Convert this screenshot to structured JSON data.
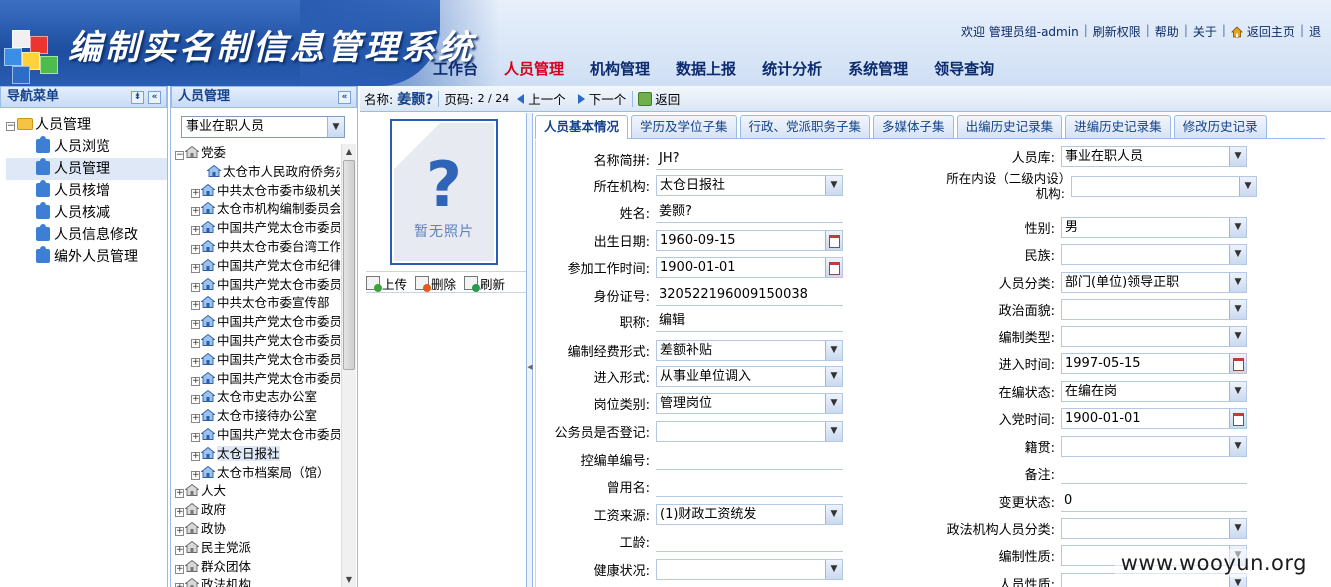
{
  "app": {
    "title": "编制实名制信息管理系统"
  },
  "top_links": {
    "welcome": "欢迎  管理员组-admin",
    "refresh": "刷新权限",
    "help": "帮助",
    "about": "关于",
    "home": "返回主页",
    "extra": "退"
  },
  "main_nav": [
    "工作台",
    "人员管理",
    "机构管理",
    "数据上报",
    "统计分析",
    "系统管理",
    "领导查询"
  ],
  "nav_panel": {
    "title": "导航菜单",
    "root": "人员管理",
    "items": [
      "人员浏览",
      "人员管理",
      "人员核增",
      "人员核减",
      "人员信息修改",
      "编外人员管理"
    ]
  },
  "person_panel": {
    "title": "人员管理",
    "status_value": "事业在职人员",
    "tree": [
      {
        "label": "党委",
        "level": 0,
        "toggle": "−"
      },
      {
        "label": "太仓市人民政府侨务办",
        "level": 2,
        "toggle": ""
      },
      {
        "label": "中共太仓市委市级机关",
        "level": 1,
        "toggle": "+"
      },
      {
        "label": "太仓市机构编制委员会",
        "level": 1,
        "toggle": "+"
      },
      {
        "label": "中国共产党太仓市委员",
        "level": 1,
        "toggle": "+"
      },
      {
        "label": "中共太仓市委台湾工作",
        "level": 1,
        "toggle": "+"
      },
      {
        "label": "中国共产党太仓市纪律",
        "level": 1,
        "toggle": "+"
      },
      {
        "label": "中国共产党太仓市委员",
        "level": 1,
        "toggle": "+"
      },
      {
        "label": "中共太仓市委宣传部",
        "level": 1,
        "toggle": "+"
      },
      {
        "label": "中国共产党太仓市委员",
        "level": 1,
        "toggle": "+"
      },
      {
        "label": "中国共产党太仓市委员",
        "level": 1,
        "toggle": "+"
      },
      {
        "label": "中国共产党太仓市委员",
        "level": 1,
        "toggle": "+"
      },
      {
        "label": "中国共产党太仓市委员",
        "level": 1,
        "toggle": "+"
      },
      {
        "label": "太仓市史志办公室",
        "level": 1,
        "toggle": "+"
      },
      {
        "label": "太仓市接待办公室",
        "level": 1,
        "toggle": "+"
      },
      {
        "label": "中国共产党太仓市委员",
        "level": 1,
        "toggle": "+"
      },
      {
        "label": "太仓日报社",
        "level": 1,
        "toggle": "+",
        "selected": true
      },
      {
        "label": "太仓市档案局（馆）",
        "level": 1,
        "toggle": "+"
      },
      {
        "label": "人大",
        "level": 0,
        "toggle": "+"
      },
      {
        "label": "政府",
        "level": 0,
        "toggle": "+"
      },
      {
        "label": "政协",
        "level": 0,
        "toggle": "+"
      },
      {
        "label": "民主党派",
        "level": 0,
        "toggle": "+"
      },
      {
        "label": "群众团体",
        "level": 0,
        "toggle": "+"
      },
      {
        "label": "政法机构",
        "level": 0,
        "toggle": "+"
      }
    ]
  },
  "toolbar": {
    "name_label": "名称:",
    "name_value": "姜颢?",
    "page_label": "页码:",
    "page_value": "2 / 24",
    "prev": "上一个",
    "next": "下一个",
    "back": "返回"
  },
  "photo": {
    "placeholder_mark": "?",
    "placeholder_text": "暂无照片",
    "upload": "上传",
    "delete": "删除",
    "refresh": "刷新"
  },
  "tabs": [
    "人员基本情况",
    "学历及学位子集",
    "行政、党派职务子集",
    "多媒体子集",
    "出编历史记录集",
    "进编历史记录集",
    "修改历史记录"
  ],
  "form_left": [
    {
      "label": "名称简拼:",
      "value": "JH?",
      "kind": "text"
    },
    {
      "label": "所在机构:",
      "value": "太仓日报社",
      "kind": "select"
    },
    {
      "label": "姓名:",
      "value": "姜颢?",
      "kind": "text"
    },
    {
      "label": "出生日期:",
      "value": "1960-09-15",
      "kind": "date"
    },
    {
      "label": "参加工作时间:",
      "value": "1900-01-01",
      "kind": "date"
    },
    {
      "label": "身份证号:",
      "value": "320522196009150038",
      "kind": "text"
    },
    {
      "label": "职称:",
      "value": "编辑",
      "kind": "text"
    },
    {
      "label": "编制经费形式:",
      "value": "差额补贴",
      "kind": "select"
    },
    {
      "label": "进入形式:",
      "value": "从事业单位调入",
      "kind": "select"
    },
    {
      "label": "岗位类别:",
      "value": "管理岗位",
      "kind": "select"
    },
    {
      "label": "公务员是否登记:",
      "value": "",
      "kind": "select"
    },
    {
      "label": "控编单编号:",
      "value": "",
      "kind": "text"
    },
    {
      "label": "曾用名:",
      "value": "",
      "kind": "text"
    },
    {
      "label": "工资来源:",
      "value": "(1)财政工资统发",
      "kind": "select"
    },
    {
      "label": "工龄:",
      "value": "",
      "kind": "text"
    },
    {
      "label": "健康状况:",
      "value": "",
      "kind": "select"
    }
  ],
  "form_right": [
    {
      "label": "人员库:",
      "value": "事业在职人员",
      "kind": "select"
    },
    {
      "label": "所在内设（二级内设）机构:",
      "value": "",
      "kind": "select",
      "tall": true
    },
    {
      "label": "性别:",
      "value": "男",
      "kind": "select"
    },
    {
      "label": "民族:",
      "value": "",
      "kind": "select"
    },
    {
      "label": "人员分类:",
      "value": "部门(单位)领导正职",
      "kind": "select"
    },
    {
      "label": "政治面貌:",
      "value": "",
      "kind": "select"
    },
    {
      "label": "编制类型:",
      "value": "",
      "kind": "select"
    },
    {
      "label": "进入时间:",
      "value": "1997-05-15",
      "kind": "date"
    },
    {
      "label": "在编状态:",
      "value": "在编在岗",
      "kind": "select"
    },
    {
      "label": "入党时间:",
      "value": "1900-01-01",
      "kind": "date"
    },
    {
      "label": "籍贯:",
      "value": "",
      "kind": "select"
    },
    {
      "label": "备注:",
      "value": "",
      "kind": "text"
    },
    {
      "label": "变更状态:",
      "value": "0",
      "kind": "text"
    },
    {
      "label": "政法机构人员分类:",
      "value": "",
      "kind": "select"
    },
    {
      "label": "编制性质:",
      "value": "",
      "kind": "select"
    },
    {
      "label": "人员性质:",
      "value": "",
      "kind": "select"
    }
  ],
  "watermark": "www.wooyun.org"
}
